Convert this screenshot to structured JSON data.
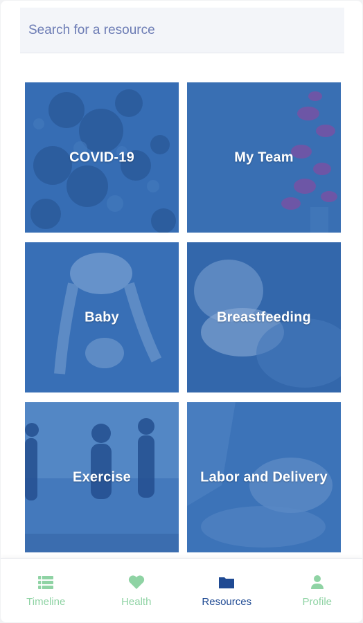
{
  "search": {
    "placeholder": "Search for a resource"
  },
  "tiles": [
    {
      "label": "COVID-19"
    },
    {
      "label": "My Team"
    },
    {
      "label": "Baby"
    },
    {
      "label": "Breastfeeding"
    },
    {
      "label": "Exercise"
    },
    {
      "label": "Labor and Delivery"
    }
  ],
  "tabbar": {
    "items": [
      {
        "label": "Timeline",
        "icon": "list-icon",
        "active": false
      },
      {
        "label": "Health",
        "icon": "heart-icon",
        "active": false
      },
      {
        "label": "Resources",
        "icon": "folder-icon",
        "active": true
      },
      {
        "label": "Profile",
        "icon": "person-icon",
        "active": false
      }
    ]
  },
  "colors": {
    "tile_overlay": "#2f64ad",
    "tab_inactive": "#8fd3a4",
    "tab_active": "#1f4a93",
    "search_text": "#6b7bb4"
  }
}
